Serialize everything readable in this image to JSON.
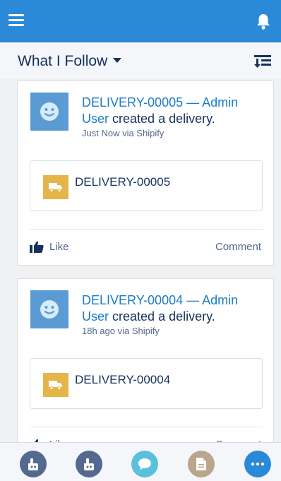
{
  "header": {
    "menu_icon": "hamburger-icon",
    "notifications_icon": "bell-icon",
    "bar_color": "#2a8ad8"
  },
  "feed": {
    "title": "What I Follow",
    "sort_icon": "sort-icon"
  },
  "posts": [
    {
      "record_link": "DELIVERY-00005",
      "separator": "—",
      "user_link": "Admin User",
      "action": "created a delivery.",
      "meta": "Just Now via Shipify",
      "record_card": "DELIVERY-00005",
      "like": "Like",
      "comment": "Comment"
    },
    {
      "record_link": "DELIVERY-00004",
      "separator": "—",
      "user_link": "Admin User",
      "action": "created a delivery.",
      "meta": "18h ago via Shipify",
      "record_card": "DELIVERY-00004",
      "like": "Like",
      "comment": "Comment"
    }
  ],
  "bottom_nav": [
    {
      "icon": "feed-action-icon",
      "color": "#54698d"
    },
    {
      "icon": "feed-action-icon",
      "color": "#54698d"
    },
    {
      "icon": "chat-icon",
      "color": "#5bc0de"
    },
    {
      "icon": "document-icon",
      "color": "#b9a68c"
    },
    {
      "icon": "more-icon",
      "color": "#2a8ad8"
    }
  ]
}
